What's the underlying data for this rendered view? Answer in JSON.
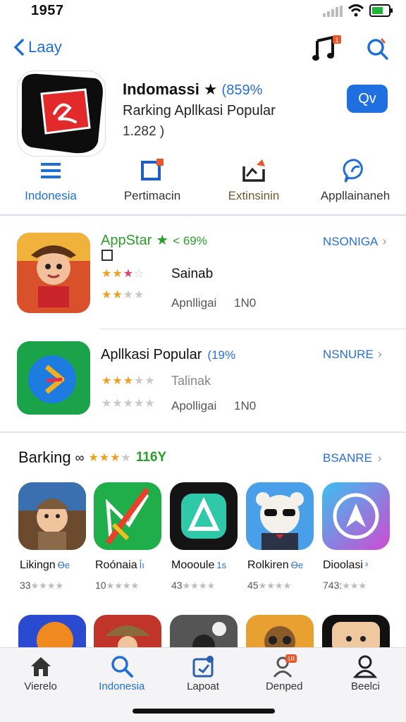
{
  "status": {
    "time": "1957"
  },
  "nav": {
    "back_label": "Laay",
    "music_badge": "1"
  },
  "hero": {
    "title": "Indomassi",
    "rating_pct": "(859%",
    "subtitle": "Rarking Apllkasi Popular",
    "count": "1.282 )",
    "get_label": "Qv"
  },
  "categories": [
    {
      "label": "Indonesia",
      "icon": "menu-icon"
    },
    {
      "label": "Pertimacin",
      "icon": "square-badge-icon"
    },
    {
      "label": "Extinsinin",
      "icon": "chart-up-icon"
    },
    {
      "label": "Appllainaneh",
      "icon": "chat-icon"
    }
  ],
  "list": [
    {
      "name": "AppStar",
      "pct": "< 69%",
      "side": "NSONIGA",
      "line2": "Sainab",
      "line3": "Apnlligai",
      "line3_value": "1N0",
      "stars1": 2.5,
      "stars2": 2.5
    },
    {
      "name": "Apllkasi Popular",
      "pct": "(19%",
      "side": "NSNURE",
      "line2": "Talinak",
      "line3": "Apolligai",
      "line3_value": "1N0",
      "stars1": 3,
      "stars2": 0
    }
  ],
  "section": {
    "title": "Barking",
    "stars": 3.5,
    "count": "116Y",
    "link": "BSANRE"
  },
  "grid": [
    {
      "name": "Likingn",
      "tag": "Ꮎe",
      "rating": "33"
    },
    {
      "name": "Roónaia",
      "tag": "I̊ı",
      "rating": "10"
    },
    {
      "name": "Moooule",
      "tag": "1s",
      "rating": "43"
    },
    {
      "name": "Rolkiren",
      "tag": "Ꮎe",
      "rating": "45"
    },
    {
      "name": "Dioolasi",
      "tag": "ᵌ",
      "rating": "743:"
    }
  ],
  "tabs": [
    {
      "label": "Vierelo",
      "icon": "home-icon"
    },
    {
      "label": "Indonesia",
      "icon": "search-icon"
    },
    {
      "label": "Lapoat",
      "icon": "calendar-icon"
    },
    {
      "label": "Denped",
      "icon": "person-badge-icon",
      "badge": "1R"
    },
    {
      "label": "Beelci",
      "icon": "profile-icon"
    }
  ],
  "colors": {
    "accent": "#1f6fd6",
    "green": "#2aa02a",
    "star": "#f0a020"
  }
}
